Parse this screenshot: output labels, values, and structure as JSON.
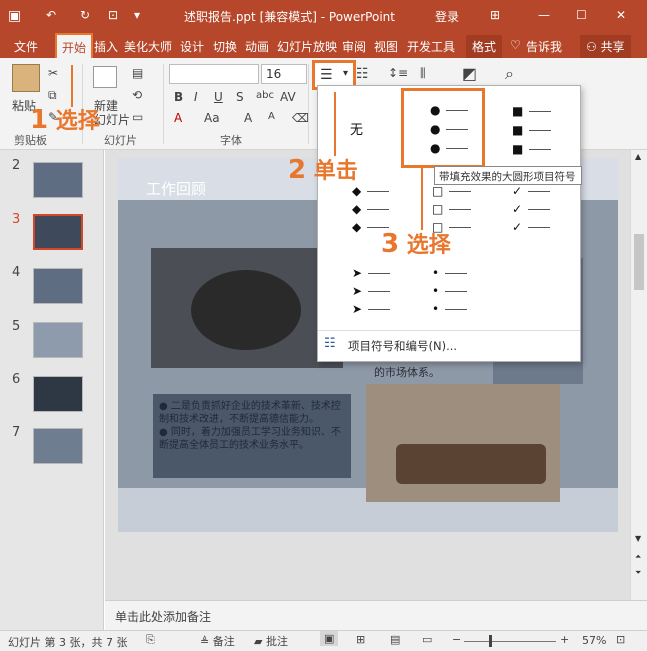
{
  "title_bar": {
    "doc_title": "述职报告.ppt [兼容模式] - PowerPoint",
    "login": "登录"
  },
  "tabs": [
    "文件",
    "开始",
    "插入",
    "美化大师",
    "设计",
    "切换",
    "动画",
    "幻灯片放映",
    "审阅",
    "视图",
    "开发工具",
    "格式"
  ],
  "tell_me": "告诉我",
  "share": "共享",
  "ribbon": {
    "paste": "粘贴",
    "new_slide": "新建",
    "new_slide_2": "幻灯片",
    "font_size": "16",
    "groups": [
      "剪贴板",
      "幻灯片",
      "字体"
    ]
  },
  "thumbnails": [
    "2",
    "3",
    "4",
    "5",
    "6",
    "7"
  ],
  "slide": {
    "heading": "工作回顾",
    "bullet_text": "● 二是负责抓好企业的技术革新、技术控制和技术改进，不断提高德信能力。\n● 同时，着力加强员工学习业务知识、不断提高全体员工的技术业务水平。",
    "side_text": "的市场体系。"
  },
  "dropdown": {
    "none_label": "无",
    "tooltip": "带填充效果的大圆形项目符号",
    "footer_label": "项目符号和编号(N)..."
  },
  "callouts": {
    "step1_num": "1",
    "step1_text": "选择",
    "step2_num": "2",
    "step2_text": "单击",
    "step3_num": "3",
    "step3_text": "选择"
  },
  "notes_placeholder": "单击此处添加备注",
  "status": {
    "slide_info": "幻灯片 第 3 张，共 7 张",
    "notes_btn": "备注",
    "comments_btn": "批注",
    "zoom": "57%"
  },
  "colors": {
    "accent": "#b7472a",
    "callout": "#e8762d"
  }
}
